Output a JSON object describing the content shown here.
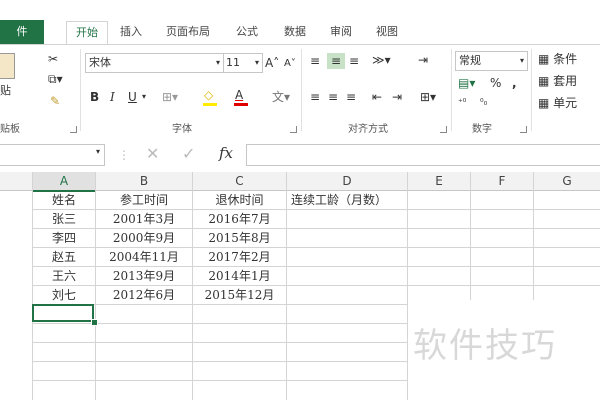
{
  "tabs": {
    "file": "件",
    "home": "开始",
    "insert": "插入",
    "page_layout": "页面布局",
    "formulas": "公式",
    "data": "数据",
    "review": "审阅",
    "view": "视图"
  },
  "ribbon": {
    "clipboard_label": "贴板",
    "paste_label": "贴",
    "font_name": "宋体",
    "font_size": "11",
    "font_group_label": "字体",
    "align_group_label": "对齐方式",
    "number_format": "常规",
    "number_group_label": "数字",
    "cond_format": "条件",
    "table_format": "套用",
    "cell_style": "单元",
    "bold": "B",
    "italic": "I",
    "underline": "U",
    "font_color_a": "A",
    "percent": "%",
    "comma": ","
  },
  "formula_bar": {
    "fx": "fx",
    "content": ""
  },
  "sheet": {
    "columns": [
      "A",
      "B",
      "C",
      "D",
      "E",
      "F",
      "G"
    ],
    "headers": [
      "姓名",
      "参工时间",
      "退休时间",
      "连续工龄（月数）"
    ],
    "rows": [
      [
        "张三",
        "2001年3月",
        "2016年7月",
        ""
      ],
      [
        "李四",
        "2000年9月",
        "2015年8月",
        ""
      ],
      [
        "赵五",
        "2004年11月",
        "2017年2月",
        ""
      ],
      [
        "王六",
        "2013年9月",
        "2014年1月",
        ""
      ],
      [
        "刘七",
        "2012年6月",
        "2015年12月",
        ""
      ]
    ]
  },
  "watermark": "软件技巧",
  "colors": {
    "accent": "#217346",
    "grid": "#d4d4d4",
    "header_bg": "#f2f2f2"
  }
}
